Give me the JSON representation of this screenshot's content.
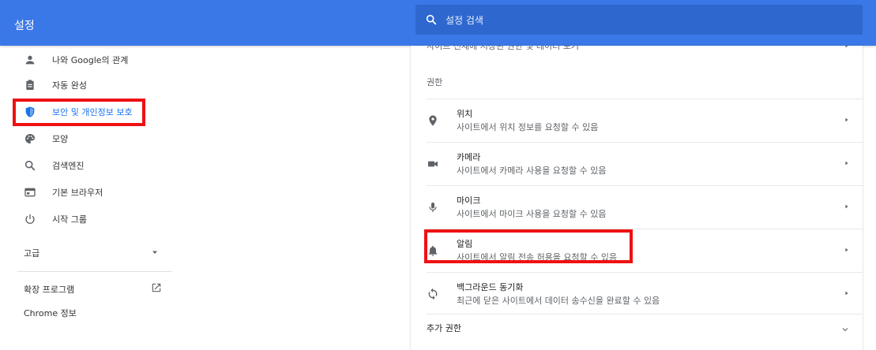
{
  "header": {
    "title": "설정",
    "search_placeholder": "설정 검색"
  },
  "sidebar": {
    "items": [
      {
        "label": "나와 Google의 관계",
        "icon": "person-icon"
      },
      {
        "label": "자동 완성",
        "icon": "clipboard-icon"
      },
      {
        "label": "보안 및 개인정보 보호",
        "icon": "shield-icon"
      },
      {
        "label": "모양",
        "icon": "palette-icon"
      },
      {
        "label": "검색엔진",
        "icon": "search-icon"
      },
      {
        "label": "기본 브라우저",
        "icon": "browser-icon"
      },
      {
        "label": "시작 그룹",
        "icon": "power-icon"
      }
    ],
    "advanced_label": "고급",
    "extensions_label": "확장 프로그램",
    "about_label": "Chrome 정보"
  },
  "content": {
    "cut_off_text": "사이트 전체에 저장된 권한 및 데이터 보기",
    "permissions_heading": "권한",
    "rows": [
      {
        "title": "위치",
        "subtitle": "사이트에서 위치 정보를 요청할 수 있음",
        "icon": "location-icon"
      },
      {
        "title": "카메라",
        "subtitle": "사이트에서 카메라 사용을 요청할 수 있음",
        "icon": "camera-icon"
      },
      {
        "title": "마이크",
        "subtitle": "사이트에서 마이크 사용을 요청할 수 있음",
        "icon": "microphone-icon"
      },
      {
        "title": "알림",
        "subtitle": "사이트에서 알림 전송 허용을 요청할 수 있음",
        "icon": "bell-icon"
      },
      {
        "title": "백그라운드 동기화",
        "subtitle": "최근에 닫은 사이트에서 데이터 송수신을 완료할 수 있음",
        "icon": "sync-icon"
      }
    ],
    "more_permissions_label": "추가 권한"
  },
  "colors": {
    "header_bg": "#3b78e7",
    "accent": "#1a73e8",
    "highlight": "#ee1111"
  }
}
